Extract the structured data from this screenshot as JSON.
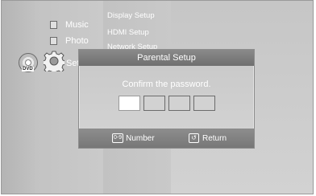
{
  "disc": {
    "label": "DVD",
    "icon": "dvd-disc-icon"
  },
  "main_menu": {
    "items": [
      {
        "label": "Music",
        "icon": "music-icon"
      },
      {
        "label": "Photo",
        "icon": "photo-icon"
      },
      {
        "label": "Set",
        "icon": "settings-gear-icon"
      }
    ]
  },
  "sub_menu": {
    "items": [
      {
        "label": "Display Setup"
      },
      {
        "label": "HDMI Setup"
      },
      {
        "label": "Network Setup"
      }
    ]
  },
  "dialog": {
    "title": "Parental Setup",
    "message": "Confirm the password.",
    "pin_slots": 4,
    "footer": {
      "number_key": "0-9",
      "number_label": "Number",
      "return_label": "Return"
    }
  }
}
